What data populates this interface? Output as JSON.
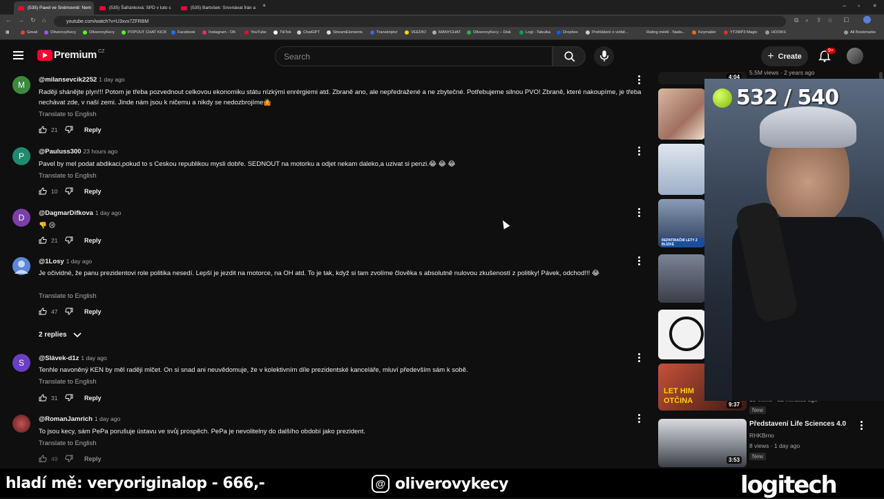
{
  "browser": {
    "tabs": [
      {
        "label": "(535) Pavel ve Sněmovně: Nem"
      },
      {
        "label": "(535) Šafránková: SPD v tuto c"
      },
      {
        "label": "(535) Bartošek: Srovnávat Írán a"
      }
    ],
    "url": "youtube.com/watch?v=U3xvx7ZFRBM",
    "bookmarks": [
      "Gmail",
      "OliverovyKecy",
      "OliverovyKecy",
      "POPOUT CHAT KICK",
      "Facebook",
      "Instagram - OK",
      "YouTube",
      "TikTok",
      "ChatGPT",
      "StreamElements",
      "Transkriptor",
      "VEEDIO",
      "MANYCHAT",
      "OliverovyKecy – Disk",
      "Logi - Tabulka",
      "Dropbox",
      "Prohlášení o volbě...",
      "Rating médií - Nada...",
      "Keymailer",
      "YT2MP3 Magic",
      "HOOKS",
      "All Bookmarks"
    ]
  },
  "header": {
    "logo_text": "Premium",
    "logo_country": "CZ",
    "search_placeholder": "Search",
    "create_label": "Create",
    "notif_count": "9+"
  },
  "comments": [
    {
      "handle": "@milansevcik2252",
      "time": "1 day ago",
      "avatar_letter": "M",
      "avatar_color": "#3b8a3e",
      "text": "Raději shánějte plyn!!! Potom je třeba pozvednout celkovou ekonomiku státu nízkými enrérgiemi atd. Zbraně ano, ale nepředražené a ne zbytečné. Potřebujeme silnou PVO!  Zbraně, které nakoupíme, je třeba nechávat zde, v naší zemi. Jinde nám jsou k ničemu a nikdy se nedozbrojíme🤷",
      "translate": "Translate to English",
      "likes": "21",
      "reply": "Reply"
    },
    {
      "handle": "@Paulus​s300",
      "time": "23 hours ago",
      "avatar_letter": "P",
      "avatar_color": "#1e8a6e",
      "text": "Pavel by mel podat abdikaci,pokud to s Ceskou republikou mysli dobře. SEDNOUT  na motorku a odjet nekam daleko,a uzivat si penzi.😂 😂 😂",
      "translate": "Translate to English",
      "likes": "10",
      "reply": "Reply"
    },
    {
      "handle": "@DagmarDifkova",
      "time": "1 day ago",
      "avatar_letter": "D",
      "avatar_color": "#7b3fa8",
      "text": "👎 😢",
      "translate": "",
      "likes": "21",
      "reply": "Reply"
    },
    {
      "handle": "@1Losy",
      "time": "1 day ago",
      "avatar_letter": "",
      "avatar_color": "#5b87d6",
      "text": "Je očividné, že panu prezidentovi role politika nesedí. Lepší je jezdit na motorce, na OH atd. To je tak, když si tam zvolíme člověka s absolutně nulovou zkušeností z politiky! Pávek, odchod!!! 😂",
      "translate": "Translate to English",
      "likes": "47",
      "reply": "Reply",
      "replies": "2 replies"
    },
    {
      "handle": "@Slávek-d1z",
      "time": "1 day ago",
      "avatar_letter": "S",
      "avatar_color": "#6a3fc0",
      "text": "Tenhle navoněný KEN by měl raději mlčet. On si snad ani neuvědomuje, že v kolektivním díle prezidentské kanceláře, mluví především sám k sobě.",
      "translate": "Translate to English",
      "likes": "31",
      "reply": "Reply"
    },
    {
      "handle": "@RomanJamrich",
      "time": "1 day ago",
      "avatar_letter": "",
      "avatar_color": "#8a2a2a",
      "text": "To jsou kecy, sám PePa porušuje ústavu ve svůj prospěch. PePa je nevolitelny do dalšího období jako prezident.",
      "translate": "Translate to English",
      "likes": "49",
      "reply": "Reply"
    }
  ],
  "sidebar": {
    "top_meta": "5.5M views · 2 years ago",
    "top_dur": "4:04",
    "partial_meta": "19 views · 22 minutes ago",
    "partial_dur": "9:37",
    "partial_new": "New",
    "video": {
      "title": "Představení Life Sciences 4.0",
      "channel": "RHKBrno",
      "meta": "8 views · 1 day ago",
      "badge": "New",
      "duration": "3:53"
    },
    "thumb_caption": "REPATRIAČNÍ LETY Z BLÍZKÉ",
    "thumb_text1": "LET HIM",
    "thumb_text2": "OTČINA"
  },
  "overlay": {
    "counter": "532 / 540",
    "ticker": "hladí mě: veryoriginalop - 666,-",
    "threads_handle": "oliverovykecy",
    "brand": "logitech"
  }
}
